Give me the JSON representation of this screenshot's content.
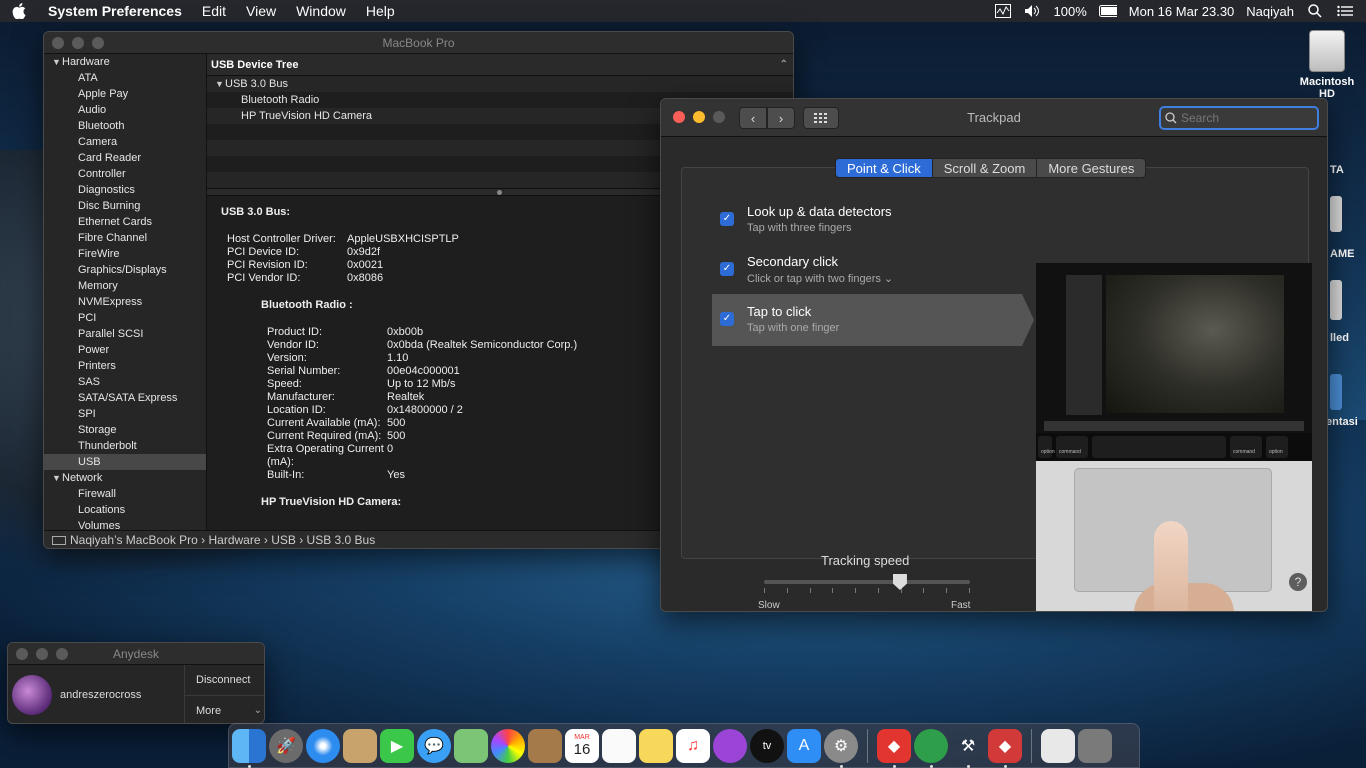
{
  "menubar": {
    "app_name": "System Preferences",
    "menus": [
      "Edit",
      "View",
      "Window",
      "Help"
    ],
    "battery": "100%",
    "datetime": "Mon 16 Mar  23.30",
    "user": "Naqiyah"
  },
  "desktop": {
    "hd_label": "Macintosh HD",
    "partial_labels": [
      "TA",
      "AME",
      "lled",
      "entasi"
    ]
  },
  "sysinfo": {
    "title": "MacBook Pro",
    "sidebar": [
      {
        "type": "group",
        "label": "Hardware"
      },
      {
        "type": "item",
        "label": "ATA"
      },
      {
        "type": "item",
        "label": "Apple Pay"
      },
      {
        "type": "item",
        "label": "Audio"
      },
      {
        "type": "item",
        "label": "Bluetooth"
      },
      {
        "type": "item",
        "label": "Camera"
      },
      {
        "type": "item",
        "label": "Card Reader"
      },
      {
        "type": "item",
        "label": "Controller"
      },
      {
        "type": "item",
        "label": "Diagnostics"
      },
      {
        "type": "item",
        "label": "Disc Burning"
      },
      {
        "type": "item",
        "label": "Ethernet Cards"
      },
      {
        "type": "item",
        "label": "Fibre Channel"
      },
      {
        "type": "item",
        "label": "FireWire"
      },
      {
        "type": "item",
        "label": "Graphics/Displays"
      },
      {
        "type": "item",
        "label": "Memory"
      },
      {
        "type": "item",
        "label": "NVMExpress"
      },
      {
        "type": "item",
        "label": "PCI"
      },
      {
        "type": "item",
        "label": "Parallel SCSI"
      },
      {
        "type": "item",
        "label": "Power"
      },
      {
        "type": "item",
        "label": "Printers"
      },
      {
        "type": "item",
        "label": "SAS"
      },
      {
        "type": "item",
        "label": "SATA/SATA Express"
      },
      {
        "type": "item",
        "label": "SPI"
      },
      {
        "type": "item",
        "label": "Storage"
      },
      {
        "type": "item",
        "label": "Thunderbolt"
      },
      {
        "type": "item",
        "label": "USB",
        "selected": true
      },
      {
        "type": "group",
        "label": "Network"
      },
      {
        "type": "item",
        "label": "Firewall"
      },
      {
        "type": "item",
        "label": "Locations"
      },
      {
        "type": "item",
        "label": "Volumes"
      }
    ],
    "tree_header": "USB Device Tree",
    "tree_bus": "USB 3.0 Bus",
    "tree_devices": [
      "Bluetooth Radio",
      "HP TrueVision HD Camera"
    ],
    "detail": {
      "heading": "USB 3.0 Bus:",
      "bus_props": [
        {
          "k": "Host Controller Driver:",
          "v": "AppleUSBXHCISPTLP"
        },
        {
          "k": "PCI Device ID:",
          "v": "0x9d2f"
        },
        {
          "k": "PCI Revision ID:",
          "v": "0x0021"
        },
        {
          "k": "PCI Vendor ID:",
          "v": "0x8086"
        }
      ],
      "bt_heading": "Bluetooth Radio :",
      "bt_props": [
        {
          "k": "Product ID:",
          "v": "0xb00b"
        },
        {
          "k": "Vendor ID:",
          "v": "0x0bda  (Realtek Semiconductor Corp.)"
        },
        {
          "k": "Version:",
          "v": "1.10"
        },
        {
          "k": "Serial Number:",
          "v": "00e04c000001"
        },
        {
          "k": "Speed:",
          "v": "Up to 12 Mb/s"
        },
        {
          "k": "Manufacturer:",
          "v": "Realtek"
        },
        {
          "k": "Location ID:",
          "v": "0x14800000 / 2"
        },
        {
          "k": "Current Available (mA):",
          "v": "500"
        },
        {
          "k": "Current Required (mA):",
          "v": "500"
        },
        {
          "k": "Extra Operating Current (mA):",
          "v": "0"
        },
        {
          "k": "Built-In:",
          "v": "Yes"
        }
      ],
      "cam_heading": "HP TrueVision HD Camera:"
    },
    "breadcrumb": "Naqiyah’s MacBook Pro › Hardware › USB  › USB 3.0 Bus"
  },
  "trackpad": {
    "title": "Trackpad",
    "search_placeholder": "Search",
    "tabs": [
      {
        "label": "Point & Click",
        "active": true
      },
      {
        "label": "Scroll & Zoom",
        "active": false
      },
      {
        "label": "More Gestures",
        "active": false
      }
    ],
    "options": [
      {
        "title": "Look up & data detectors",
        "subtitle": "Tap with three fingers",
        "checked": true
      },
      {
        "title": "Secondary click",
        "subtitle": "Click or tap with two fingers ⌄",
        "checked": true
      },
      {
        "title": "Tap to click",
        "subtitle": "Tap with one finger",
        "checked": true,
        "selected": true
      }
    ],
    "tracking_label": "Tracking speed",
    "slow_label": "Slow",
    "fast_label": "Fast",
    "tracking_value": 0.66,
    "preview_keys": [
      "option",
      "command",
      "command",
      "option"
    ],
    "help": "?"
  },
  "anydesk": {
    "title": "Anydesk",
    "user": "andreszerocross",
    "disconnect": "Disconnect",
    "more": "More"
  },
  "dock": {
    "calendar_month": "MAR",
    "calendar_day": "16",
    "tv_label": "tv"
  },
  "colors": {
    "accent": "#2d6cd6",
    "close": "#fc5f57",
    "minimize": "#fdbc2e"
  }
}
